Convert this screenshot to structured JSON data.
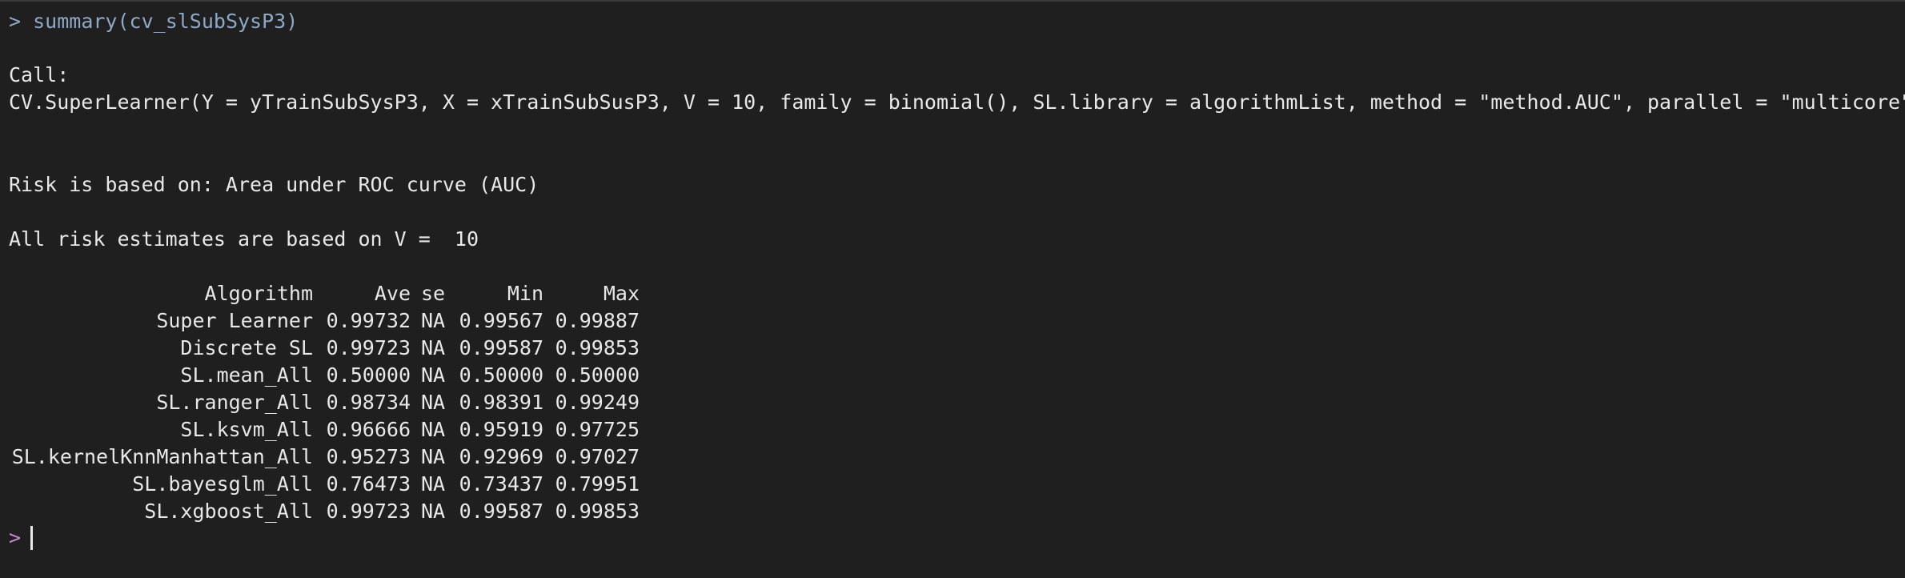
{
  "console": {
    "prompt_symbol": ">",
    "command": "summary(cv_slSubSysP3)",
    "call_label": "Call:",
    "call_text": "CV.SuperLearner(Y = yTrainSubSysP3, X = xTrainSubSusP3, V = 10, family = binomial(), SL.library = algorithmList, method = \"method.AUC\", parallel = \"multicore\")",
    "risk_text": "Risk is based on: Area under ROC curve (AUC)",
    "estimates_text": "All risk estimates are based on V =  10",
    "table": {
      "headers": [
        "Algorithm",
        "Ave",
        "se",
        "Min",
        "Max"
      ],
      "rows": [
        [
          "Super Learner",
          "0.99732",
          "NA",
          "0.99567",
          "0.99887"
        ],
        [
          "Discrete SL",
          "0.99723",
          "NA",
          "0.99587",
          "0.99853"
        ],
        [
          "SL.mean_All",
          "0.50000",
          "NA",
          "0.50000",
          "0.50000"
        ],
        [
          "SL.ranger_All",
          "0.98734",
          "NA",
          "0.98391",
          "0.99249"
        ],
        [
          "SL.ksvm_All",
          "0.96666",
          "NA",
          "0.95919",
          "0.97725"
        ],
        [
          "SL.kernelKnnManhattan_All",
          "0.95273",
          "NA",
          "0.92969",
          "0.97027"
        ],
        [
          "SL.bayesglm_All",
          "0.76473",
          "NA",
          "0.73437",
          "0.79951"
        ],
        [
          "SL.xgboost_All",
          "0.99723",
          "NA",
          "0.99587",
          "0.99853"
        ]
      ]
    },
    "final_prompt": ">"
  },
  "colors": {
    "background": "#1f1f1f",
    "text": "#e8e8e8",
    "command": "#8ea8c8",
    "final_prompt": "#c78bd0"
  }
}
